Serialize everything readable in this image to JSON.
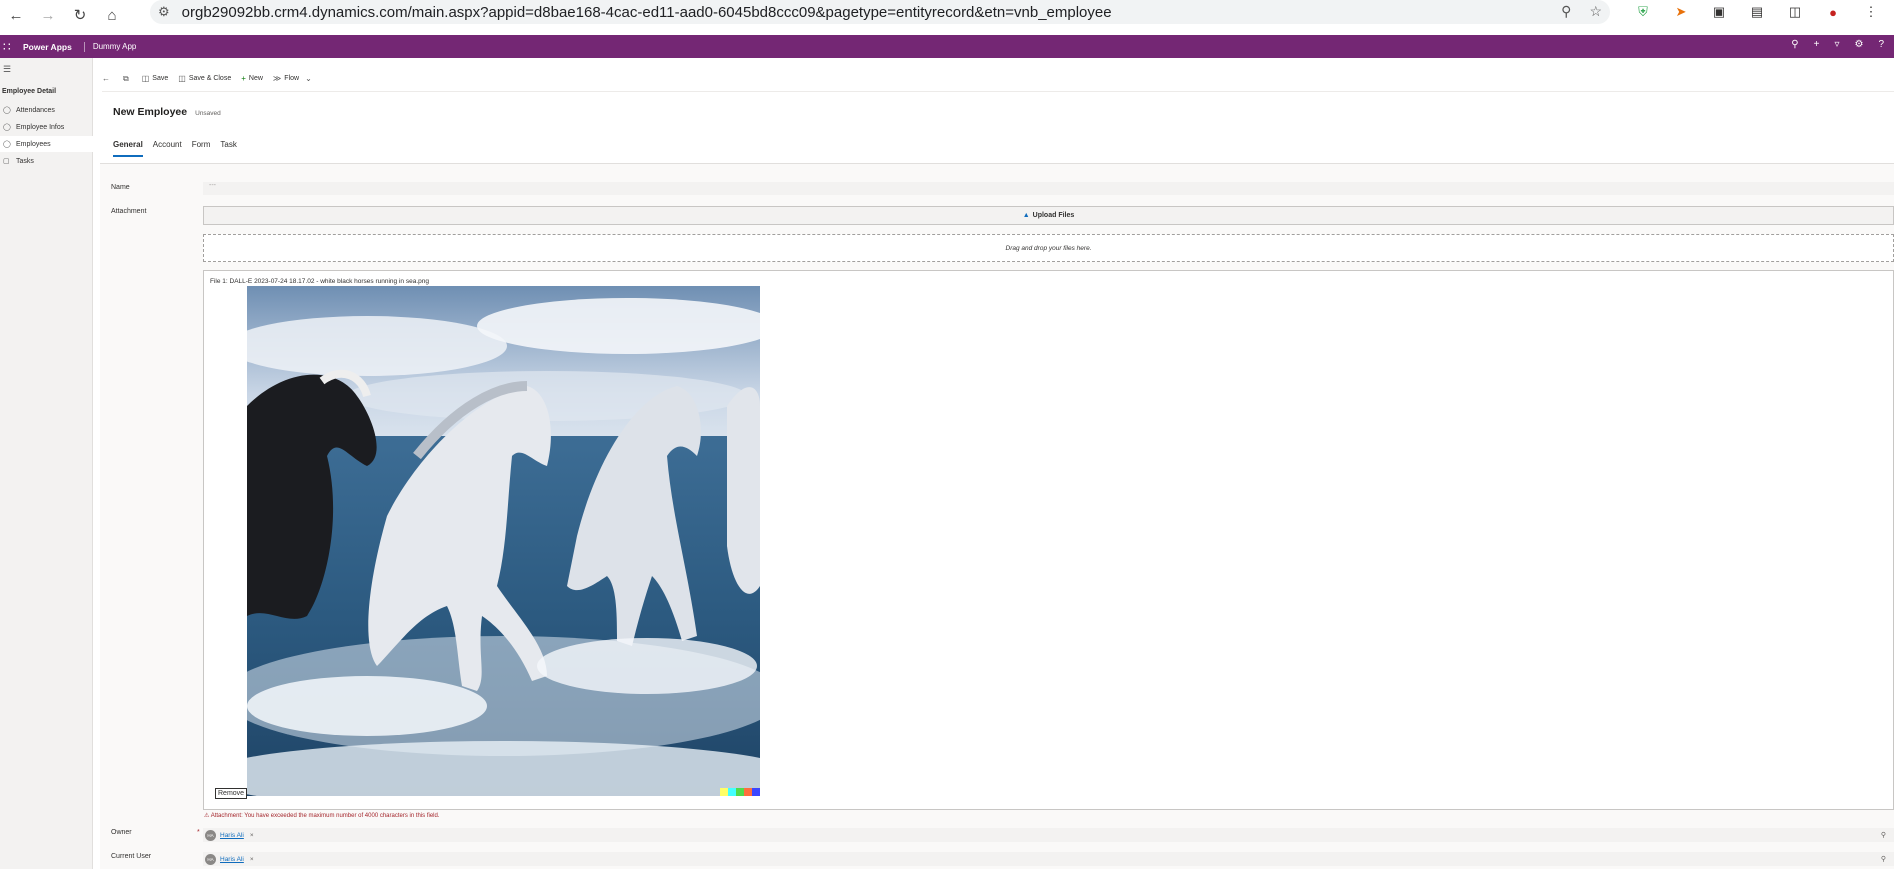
{
  "browser": {
    "url": "orgb29092bb.crm4.dynamics.com/main.aspx?appid=d8bae168-4cac-ed11-aad0-6045bd8ccc09&pagetype=entityrecord&etn=vnb_employee"
  },
  "header": {
    "brand": "Power Apps",
    "app_name": "Dummy App"
  },
  "sidebar": {
    "group": "Employee Detail",
    "items": [
      {
        "label": "Attendances"
      },
      {
        "label": "Employee Infos"
      },
      {
        "label": "Employees"
      },
      {
        "label": "Tasks"
      }
    ]
  },
  "commands": {
    "save": "Save",
    "save_close": "Save & Close",
    "new": "New",
    "flow": "Flow"
  },
  "form": {
    "title": "New Employee",
    "status": "Unsaved",
    "tabs": [
      "General",
      "Account",
      "Form",
      "Task"
    ],
    "name_label": "Name",
    "name_placeholder": "---",
    "attachment_label": "Attachment",
    "upload_label": "Upload Files",
    "drop_text": "Drag and drop your files here.",
    "file_name": "File 1: DALL-E 2023-07-24 18.17.02 - white black horses running in sea.png",
    "remove_label": "Remove",
    "error": "Attachment: You have exceeded the maximum number of 4000 characters in this field.",
    "owner_label": "Owner",
    "owner_value": "Haris Ali",
    "current_user_label": "Current User",
    "current_user_value": "Haris Ali",
    "avatar_initials": "HA"
  }
}
